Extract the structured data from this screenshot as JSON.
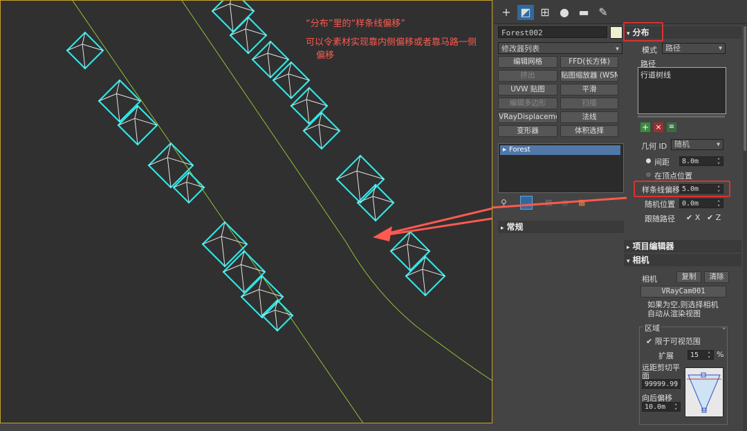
{
  "annotation": {
    "title": "“分布”里的“样条线偏移”",
    "body_line1": "可以令素材实现靠内侧偏移或者靠马路一侧",
    "body_line2": "偏移"
  },
  "toolbar": {
    "icons": [
      "create-plus-icon",
      "modify-icon",
      "hierarchy-icon",
      "motion-icon",
      "display-icon",
      "utilities-wrench-icon"
    ]
  },
  "modifier_panel": {
    "object_name": "Forest002",
    "modifier_list": "修改器列表",
    "buttons": [
      {
        "label": "编辑网格",
        "disabled": false
      },
      {
        "label": "FFD(长方体)",
        "disabled": false
      },
      {
        "label": "挤出",
        "disabled": true
      },
      {
        "label": "贴图缩放器 (WSM)",
        "disabled": false
      },
      {
        "label": "UVW 贴图",
        "disabled": false
      },
      {
        "label": "平滑",
        "disabled": false
      },
      {
        "label": "编辑多边形",
        "disabled": true
      },
      {
        "label": "扫描",
        "disabled": true
      },
      {
        "label": "VRayDisplacementM",
        "disabled": false
      },
      {
        "label": "法线",
        "disabled": false
      },
      {
        "label": "变形器",
        "disabled": false
      },
      {
        "label": "体积选择",
        "disabled": false
      }
    ],
    "stack_item": "Forest",
    "rollout_general": "常规"
  },
  "distribution": {
    "header": "分布",
    "mode_label": "模式",
    "mode_value": "路径",
    "path_label": "路径",
    "path_item": "行道树线",
    "geometry_label": "几何 ID",
    "geometry_value": "随机",
    "spacing_label": "间距",
    "spacing_value": "8.0m",
    "at_vertex_label": "在顶点位置",
    "spline_offset_label": "样条线偏移",
    "spline_offset_value": "5.0m",
    "random_pos_label": "随机位置",
    "random_pos_value": "0.0m",
    "follow_path_label": "跟随路径",
    "follow_x": "X",
    "follow_z": "Z"
  },
  "item_editor": {
    "header": "项目编辑器"
  },
  "camera": {
    "header": "相机",
    "camera_label": "相机",
    "copy_button": "复制",
    "clear_button": "清除",
    "camera_value": "VRayCam001",
    "note_line1": "如果为空,则选择相机",
    "note_line2": "自动从渲染视图",
    "region_label": "区域",
    "limit_label": "限于可视范围",
    "expand_label": "扩展",
    "expand_value": "15",
    "expand_unit": "%",
    "far_clip_label_1": "远距剪切平",
    "far_clip_label_2": "面",
    "far_clip_value": "99999.99",
    "back_offset_label": "向后偏移",
    "back_offset_value": "10.0m"
  },
  "colors": {
    "accent_cyan": "#2fe6e6",
    "highlight_red": "#e03030",
    "annotation_red": "#ff5a4f",
    "spline_green": "#8fc23a"
  }
}
